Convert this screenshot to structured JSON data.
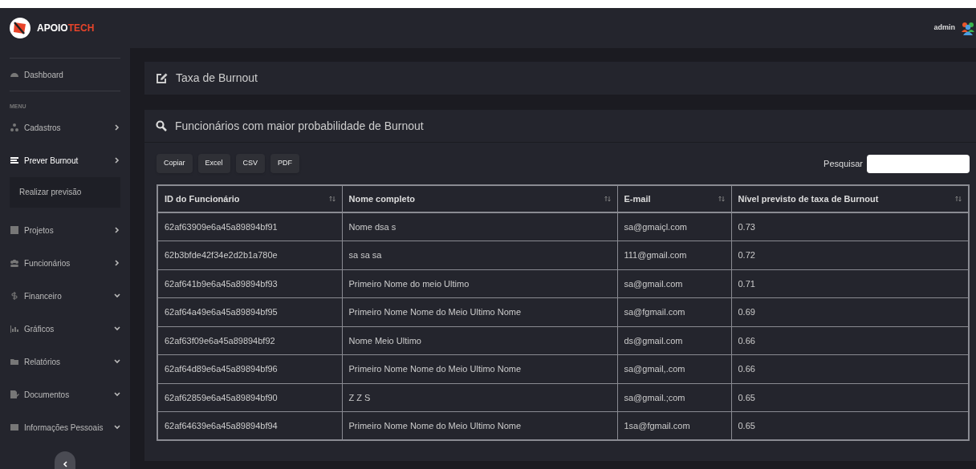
{
  "brand": {
    "name_first": "APOIO",
    "name_second": "TECH"
  },
  "sidebar": {
    "top_item": {
      "label": "Dashboard",
      "selected": false
    },
    "section_label": "MENU",
    "items": [
      {
        "label": "Cadastros",
        "kind": "submenu",
        "selected": false
      },
      {
        "label": "Prever Burnout",
        "kind": "submenu",
        "selected": true,
        "children": [
          {
            "label": "Realizar previsão",
            "selected": false
          }
        ]
      },
      {
        "label": "Projetos",
        "kind": "submenu",
        "selected": false
      },
      {
        "label": "Funcionários",
        "kind": "submenu",
        "selected": false
      },
      {
        "label": "Financeiro",
        "kind": "dropdown",
        "selected": false
      },
      {
        "label": "Gráficos",
        "kind": "dropdown",
        "selected": false
      },
      {
        "label": "Relatórios",
        "kind": "dropdown",
        "selected": false
      },
      {
        "label": "Documentos",
        "kind": "dropdown",
        "selected": false
      },
      {
        "label": "Informações Pessoais",
        "kind": "dropdown",
        "selected": false
      }
    ]
  },
  "header": {
    "user": "admin"
  },
  "page_title": "Taxa de Burnout",
  "card": {
    "title": "Funcionários com maior probabilidade de Burnout",
    "export_buttons": [
      "Copiar",
      "Excel",
      "CSV",
      "PDF"
    ],
    "search": {
      "label": "Pesquisar"
    },
    "table": {
      "columns": [
        "ID do Funcionário",
        "Nome completo",
        "E-mail",
        "Nível previsto de taxa de Burnout"
      ],
      "rows": [
        [
          "62af63909e6a45a89894bf91",
          "Nome dsa s",
          "sa@gmaiçl.com",
          "0.73"
        ],
        [
          "62b3bfde42f34e2d2b1a780e",
          "sa sa sa",
          "111@gmail.com",
          "0.72"
        ],
        [
          "62af641b9e6a45a89894bf93",
          "Primeiro Nome do meio Ultimo",
          "sa@gmail.com",
          "0.71"
        ],
        [
          "62af64a49e6a45a89894bf95",
          "Primeiro Nome Nome do Meio Ultimo Nome",
          "sa@fgmail.com",
          "0.69"
        ],
        [
          "62af63f09e6a45a89894bf92",
          "Nome Meio Ultimo",
          "ds@gmail.com",
          "0.66"
        ],
        [
          "62af64d89e6a45a89894bf96",
          "Primeiro Nome Nome do Meio Ultimo Nome",
          "sa@gmail,.com",
          "0.66"
        ],
        [
          "62af62859e6a45a89894bf90",
          "Z Z S",
          "sa@gmail.;com",
          "0.65"
        ],
        [
          "62af64639e6a45a89894bf94",
          "Primeiro Nome Nome do Meio Ultimo Nome",
          "1sa@fgmail.com",
          "0.65"
        ]
      ]
    }
  }
}
